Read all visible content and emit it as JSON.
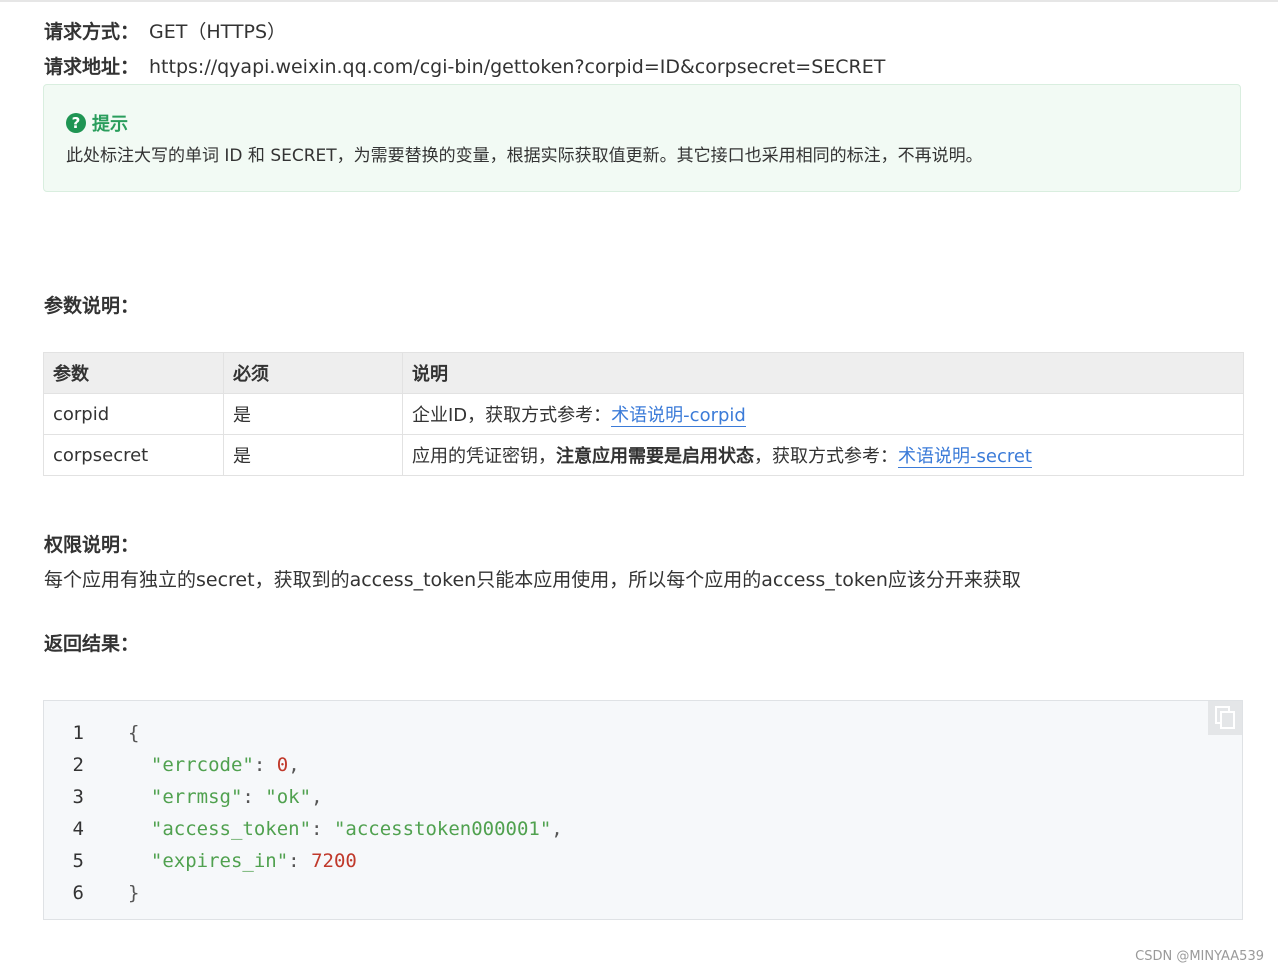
{
  "request": {
    "method_label": "请求方式：",
    "method_value": "GET（HTTPS）",
    "url_label": "请求地址：",
    "url_value": "https://qyapi.weixin.qq.com/cgi-bin/gettoken?corpid=ID&corpsecret=SECRET"
  },
  "tip": {
    "icon": "question-circle-icon",
    "title": "提示",
    "text": "此处标注大写的单词 ID 和 SECRET，为需要替换的变量，根据实际获取值更新。其它接口也采用相同的标注，不再说明。",
    "accent_color": "#2a9d5c"
  },
  "params": {
    "heading": "参数说明：",
    "headers": [
      "参数",
      "必须",
      "说明"
    ],
    "rows": [
      {
        "name": "corpid",
        "required": "是",
        "desc_prefix": "企业ID，获取方式参考：",
        "desc_bold": "",
        "desc_middle": "",
        "link": "术语说明-corpid"
      },
      {
        "name": "corpsecret",
        "required": "是",
        "desc_prefix": "应用的凭证密钥，",
        "desc_bold": "注意应用需要是启用状态",
        "desc_middle": "，获取方式参考：",
        "link": "术语说明-secret"
      }
    ],
    "link_color": "#3b7bd8"
  },
  "permission": {
    "heading": "权限说明：",
    "text": "每个应用有独立的secret，获取到的access_token只能本应用使用，所以每个应用的access_token应该分开来获取"
  },
  "result": {
    "heading": "返回结果：",
    "copy_icon": "copy-icon",
    "lines": [
      {
        "no": "1",
        "open": "{"
      },
      {
        "no": "2",
        "key": "\"errcode\"",
        "value": "0",
        "value_type": "num",
        "trail": ","
      },
      {
        "no": "3",
        "key": "\"errmsg\"",
        "value": "\"ok\"",
        "value_type": "str",
        "trail": ","
      },
      {
        "no": "4",
        "key": "\"access_token\"",
        "value": "\"accesstoken000001\"",
        "value_type": "str",
        "trail": ","
      },
      {
        "no": "5",
        "key": "\"expires_in\"",
        "value": "7200",
        "value_type": "num",
        "trail": ""
      },
      {
        "no": "6",
        "close": "}"
      }
    ]
  },
  "watermark": "CSDN @MINYAA539"
}
